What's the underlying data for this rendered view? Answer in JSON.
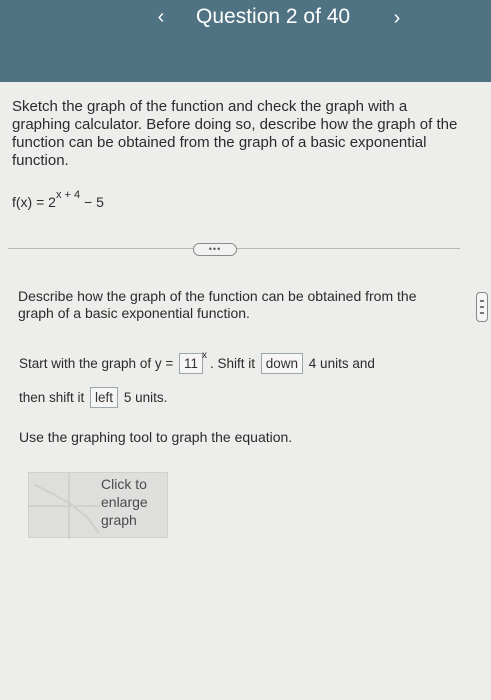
{
  "header": {
    "title": "Question 2 of 40",
    "prev_icon": "‹",
    "next_icon": "›"
  },
  "question": {
    "text": "Sketch the graph of the function and check the graph with a graphing calculator. Before doing so, describe how the graph of the function can be obtained from the graph of a basic exponential function.",
    "formula_lhs": "f(x) = 2",
    "formula_exponent": "x + 4",
    "formula_rhs": " − 5"
  },
  "more_button": "•••",
  "describe_prompt": "Describe how the graph of the function can be obtained from the graph of a basic exponential function.",
  "answer": {
    "start_text": "Start with the graph of y = ",
    "base_value": "11",
    "exponent": "x",
    "shift_text": ". Shift it ",
    "direction1": "down",
    "units1_text": " 4 units and",
    "then_text": "then shift it ",
    "direction2": "left",
    "units2_text": " 5 units."
  },
  "instruction": "Use the graphing tool to graph the equation.",
  "graph_thumb": {
    "label": "Click to enlarge graph"
  },
  "colors": {
    "header": "#4f7383",
    "background": "#ededeb"
  }
}
